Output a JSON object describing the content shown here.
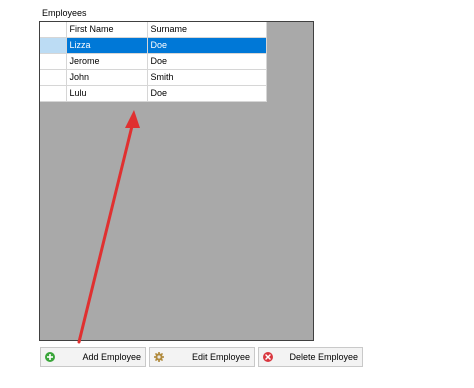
{
  "group": {
    "label": "Employees"
  },
  "grid": {
    "columns": [
      "First Name",
      "Surname"
    ],
    "rows": [
      {
        "first_name": "Lizza",
        "surname": "Doe",
        "selected": true
      },
      {
        "first_name": "Jerome",
        "surname": "Doe",
        "selected": false
      },
      {
        "first_name": "John",
        "surname": "Smith",
        "selected": false
      },
      {
        "first_name": "Lulu",
        "surname": "Doe",
        "selected": false
      }
    ]
  },
  "buttons": {
    "add": {
      "label": "Add Employee",
      "icon": "plus-circle-icon",
      "icon_color": "#3aa53a"
    },
    "edit": {
      "label": "Edit Employee",
      "icon": "gear-icon",
      "icon_color": "#b08a3c"
    },
    "delete": {
      "label": "Delete Employee",
      "icon": "close-circle-icon",
      "icon_color": "#d9363e"
    }
  },
  "annotation": {
    "arrow_color": "#e03030"
  }
}
